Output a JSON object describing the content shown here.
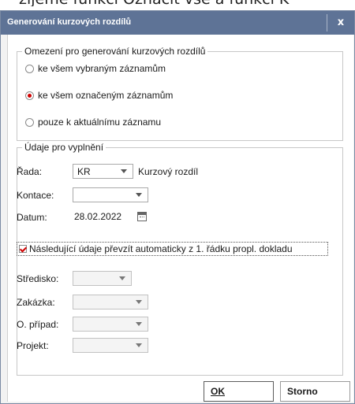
{
  "background_text": "zíjeme funkci Označit vše a funkci K",
  "dialog": {
    "title": "Generování kurzových rozdílů",
    "close_label": "x"
  },
  "scope_group": {
    "legend": "Omezení pro generování kurzových rozdílů",
    "options": [
      {
        "label": "ke všem vybraným záznamům",
        "checked": false
      },
      {
        "label": "ke všem označeným záznamům",
        "checked": true
      },
      {
        "label": "pouze k aktuálnímu záznamu",
        "checked": false
      }
    ]
  },
  "fill_group": {
    "legend": "Údaje pro vyplnění",
    "rada_label": "Řada:",
    "rada_value": "KR",
    "rada_name": "Kurzový rozdíl",
    "kontace_label": "Kontace:",
    "kontace_value": "",
    "datum_label": "Datum:",
    "datum_value": "28.02.2022",
    "take_over_label": "Následující údaje převzít automaticky z 1. řádku propl. dokladu",
    "take_over_checked": true,
    "stredisko_label": "Středisko:",
    "zakazka_label": "Zakázka:",
    "oprip_label": "O. případ:",
    "projekt_label": "Projekt:"
  },
  "buttons": {
    "ok_label": "OK",
    "storno_label": "Storno"
  },
  "colors": {
    "titlebar": "#5e7396",
    "accent_red": "#d00000",
    "dialog_bg": "#f2f2f2"
  }
}
